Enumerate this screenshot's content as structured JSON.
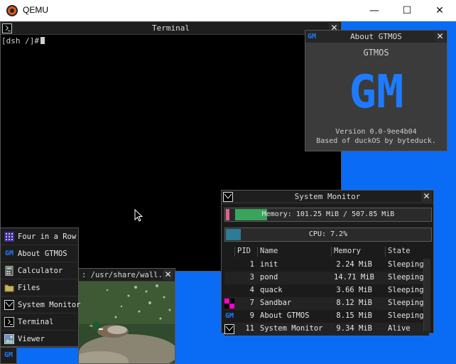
{
  "host": {
    "title": "QEMU",
    "minimize": "—",
    "maximize": "☐",
    "close": "✕"
  },
  "terminal": {
    "title": "Terminal",
    "prompt_prefix": "[dsh /]#",
    "close": "✕"
  },
  "about": {
    "title": "About GTMOS",
    "icon_text": "GM",
    "heading": "GTMOS",
    "logo_text": "GM",
    "version": "Version 0.0-9ee4b04",
    "based_on": "Based of duckOS by byteduck.",
    "close": "✕"
  },
  "sysmon": {
    "title": "System Monitor",
    "close": "✕",
    "memory": {
      "label": "Memory: 101.25 MiB / 507.85 MiB",
      "used_fraction": 0.199,
      "colors": {
        "pink": "#e0608a",
        "green": "#3aa35c"
      }
    },
    "cpu": {
      "label": "CPU: 7.2%",
      "fraction": 0.072,
      "color": "#2f7a94"
    },
    "columns": [
      "PID",
      "Name",
      "Memory",
      "State"
    ],
    "processes": [
      {
        "pid": "1",
        "name": "init",
        "memory": "2.24 MiB",
        "state": "Sleeping",
        "icon": "none"
      },
      {
        "pid": "3",
        "name": "pond",
        "memory": "14.71 MiB",
        "state": "Sleeping",
        "icon": "none"
      },
      {
        "pid": "4",
        "name": "quack",
        "memory": "3.66 MiB",
        "state": "Sleeping",
        "icon": "none"
      },
      {
        "pid": "7",
        "name": "Sandbar",
        "memory": "8.12 MiB",
        "state": "Sleeping",
        "icon": "checker-icon"
      },
      {
        "pid": "9",
        "name": "About GTMOS",
        "memory": "8.15 MiB",
        "state": "Sleeping",
        "icon": "gm-icon",
        "icon_text": "GM"
      },
      {
        "pid": "11",
        "name": "System Monitor",
        "memory": "9.34 MiB",
        "state": "Alive",
        "icon": "sysmon-icon"
      }
    ]
  },
  "viewer": {
    "title": ": /usr/share/wall...",
    "close": "✕"
  },
  "startmenu": {
    "items": [
      {
        "label": "Four in a Row",
        "icon": "grid-icon"
      },
      {
        "label": "About GTMOS",
        "icon": "gm-icon",
        "icon_text": "GM"
      },
      {
        "label": "Calculator",
        "icon": "calculator-icon"
      },
      {
        "label": "Files",
        "icon": "folder-icon"
      },
      {
        "label": "System Monitor",
        "icon": "sysmon-icon"
      },
      {
        "label": "Terminal",
        "icon": "terminal-icon"
      },
      {
        "label": "Viewer",
        "icon": "viewer-icon"
      }
    ],
    "taskbar_text": "GM"
  },
  "colors": {
    "desktop": "#0a6cf5",
    "accent_blue": "#1e7bff"
  }
}
